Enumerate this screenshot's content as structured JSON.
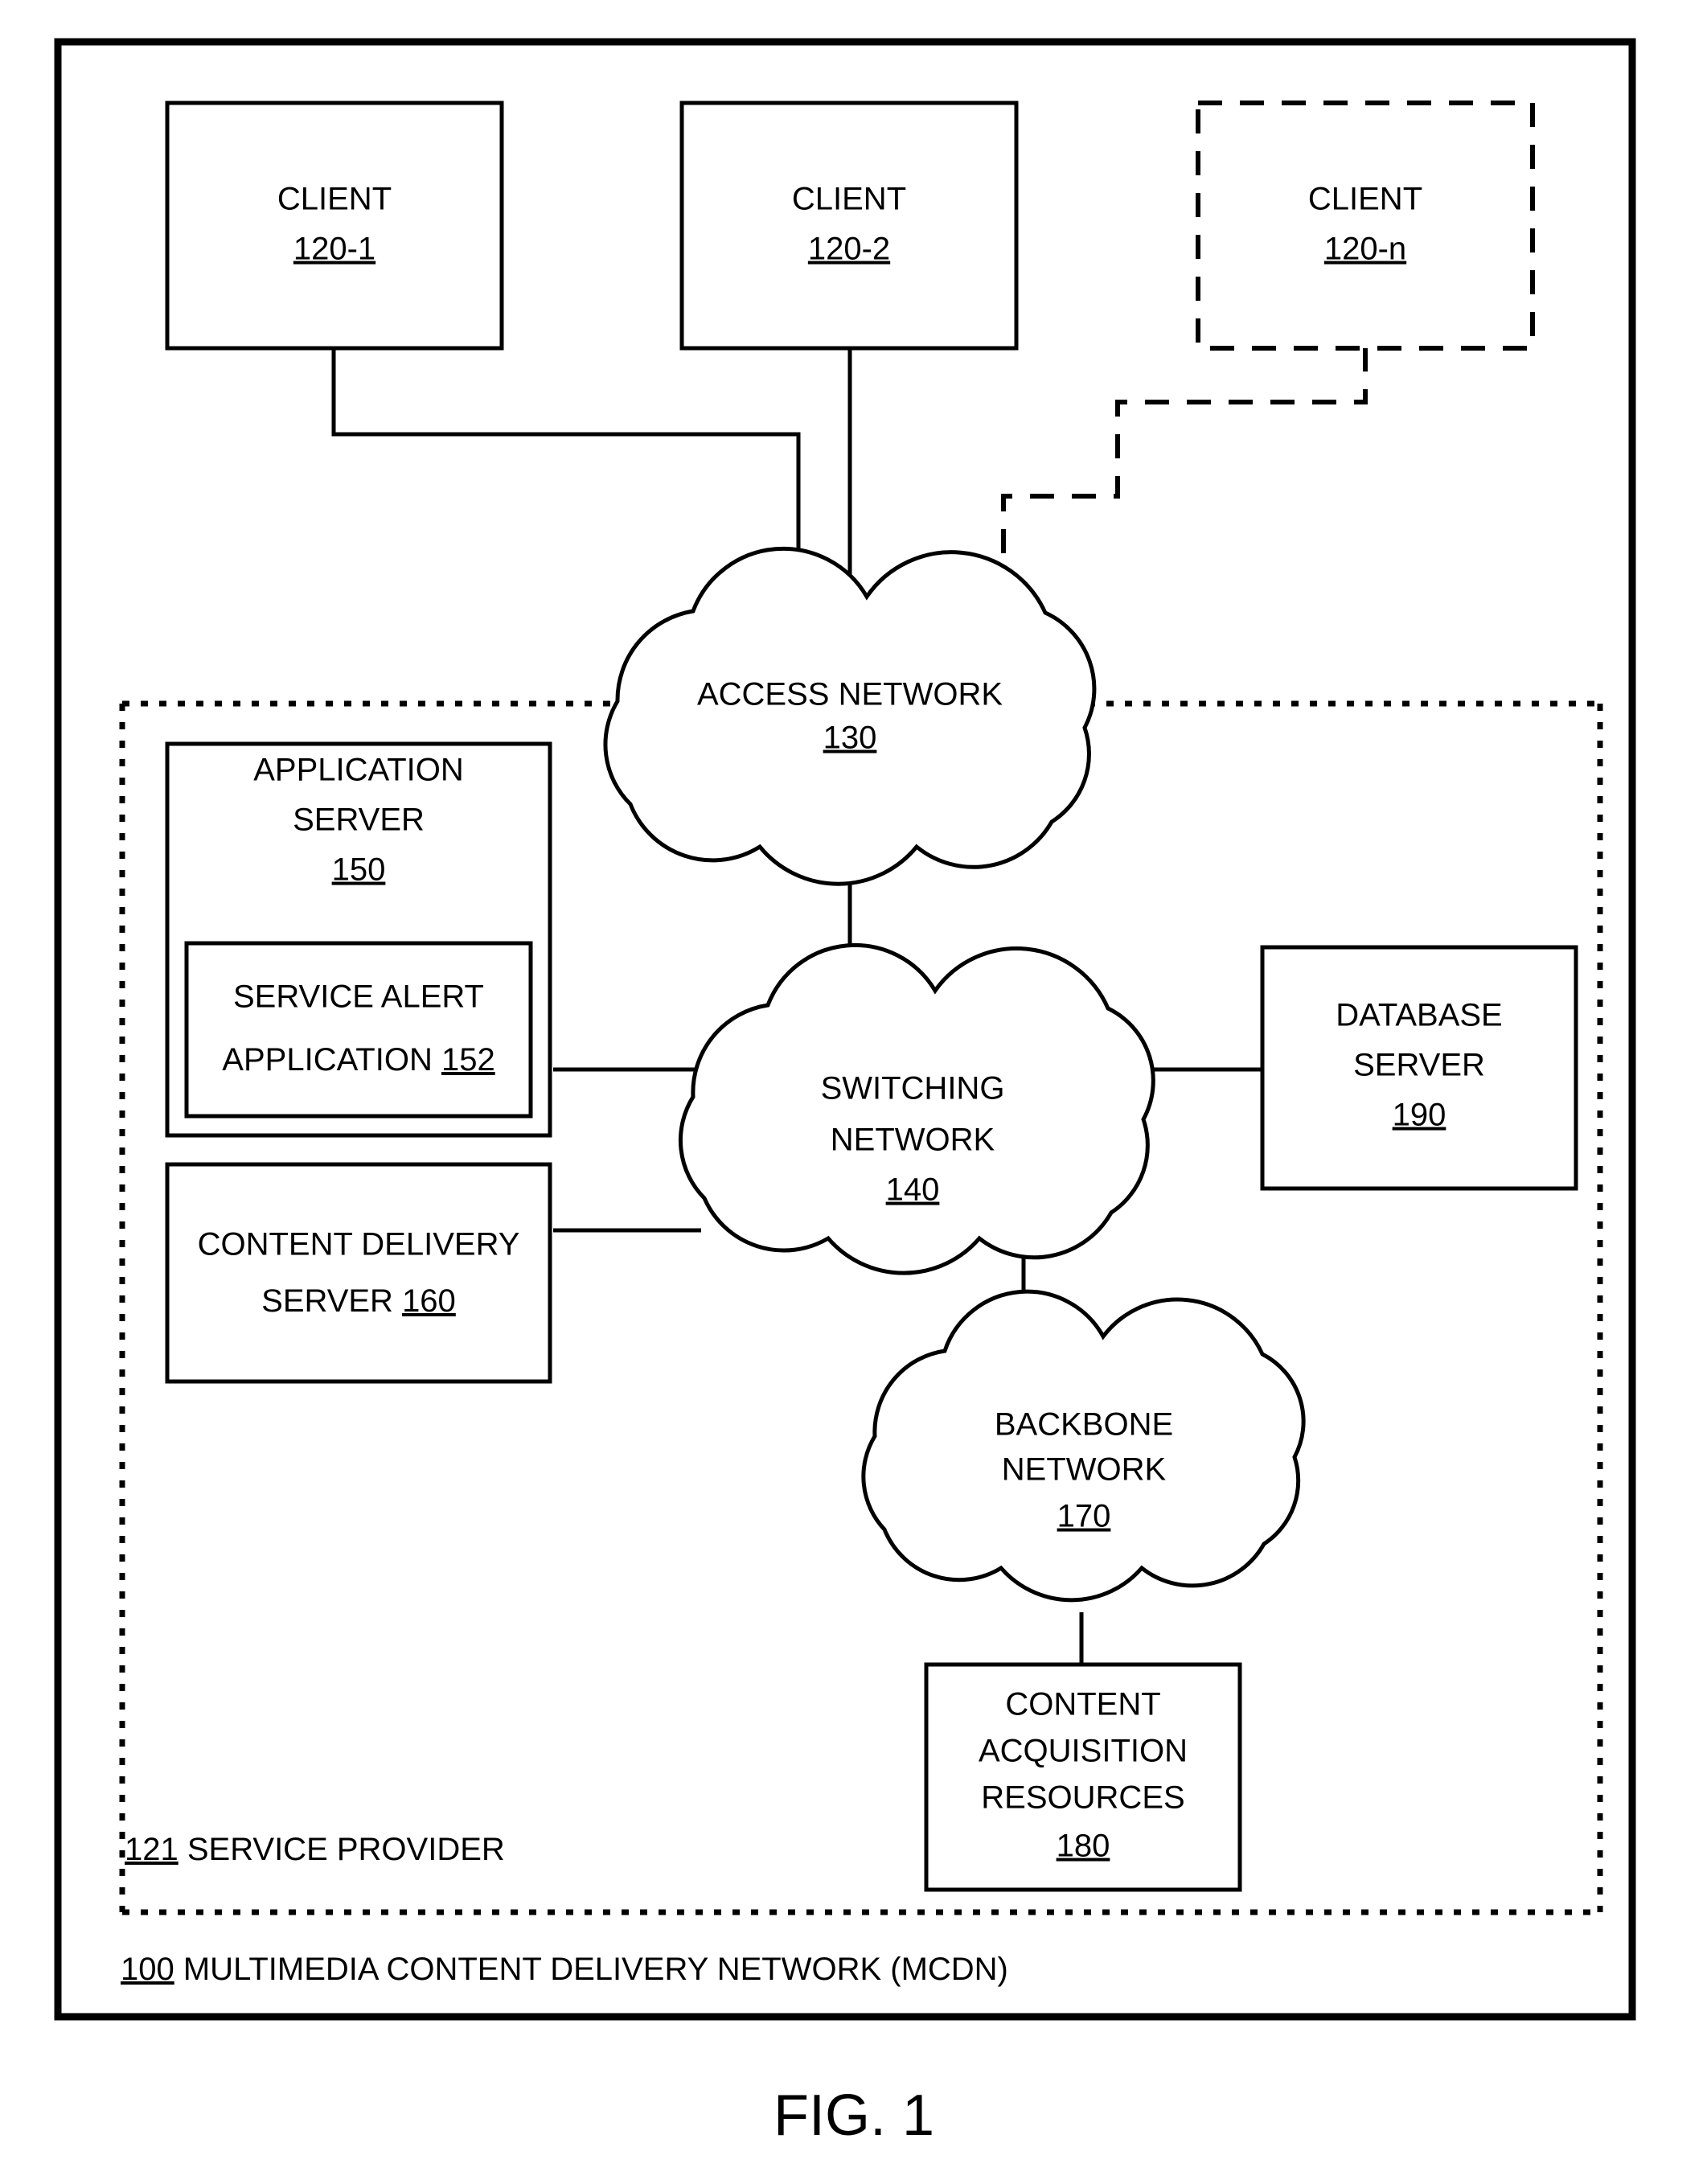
{
  "figure": {
    "caption": "FIG. 1",
    "outer_label_ref": "100",
    "outer_label_text": " MULTIMEDIA CONTENT DELIVERY NETWORK (MCDN)",
    "provider_label_ref": "121",
    "provider_label_text": " SERVICE PROVIDER"
  },
  "nodes": {
    "client1": {
      "label": "CLIENT",
      "ref": "120-1",
      "style": "solid-box"
    },
    "client2": {
      "label": "CLIENT",
      "ref": "120-2",
      "style": "solid-box"
    },
    "clientn": {
      "label": "CLIENT",
      "ref": "120-n",
      "style": "dashed-box"
    },
    "access_network": {
      "line1": "ACCESS NETWORK",
      "ref": "130",
      "style": "cloud"
    },
    "switching_network": {
      "line1": "SWITCHING",
      "line2": "NETWORK",
      "ref": "140",
      "style": "cloud"
    },
    "backbone_network": {
      "line1": "BACKBONE",
      "line2": "NETWORK",
      "ref": "170",
      "style": "cloud"
    },
    "application_server": {
      "line1": "APPLICATION",
      "line2": "SERVER",
      "ref": "150",
      "style": "solid-box"
    },
    "service_alert_application": {
      "line1": "SERVICE ALERT",
      "line2": "APPLICATION ",
      "ref": "152",
      "style": "inner-box"
    },
    "content_delivery_server": {
      "line1": "CONTENT DELIVERY",
      "line2": "SERVER ",
      "ref": "160",
      "style": "solid-box"
    },
    "database_server": {
      "line1": "DATABASE",
      "line2": "SERVER",
      "ref": "190",
      "style": "solid-box"
    },
    "content_acquisition_resources": {
      "line1": "CONTENT",
      "line2": "ACQUISITION",
      "line3": "RESOURCES",
      "ref": "180",
      "style": "solid-box"
    }
  },
  "colors": {
    "stroke": "#000000",
    "fill": "#ffffff"
  }
}
